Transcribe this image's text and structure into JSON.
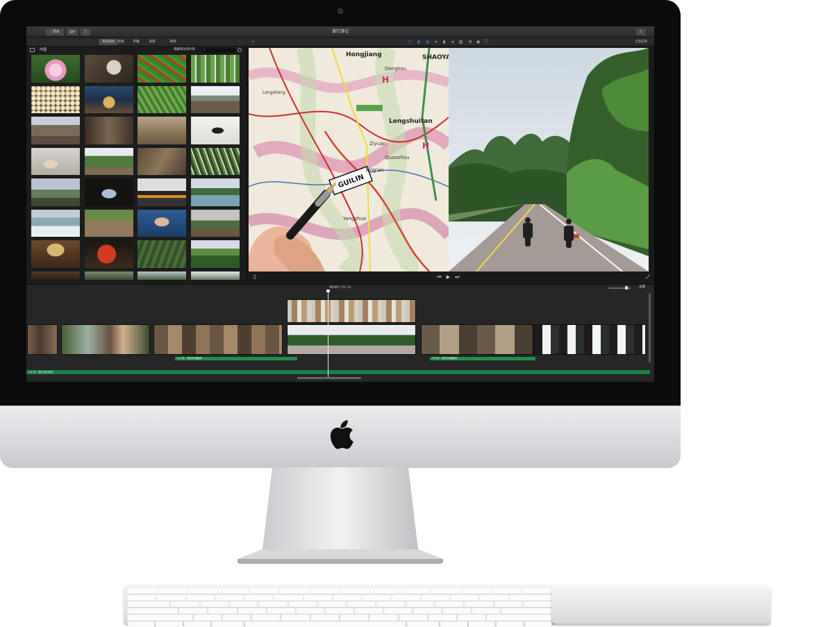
{
  "app": {
    "window_title": "旅行游记",
    "back_button_label": "项目",
    "tabs": [
      "我的媒体",
      "音频",
      "字幕",
      "背景",
      "转场"
    ],
    "reset_all_label": "全部还原"
  },
  "library": {
    "title": "中国",
    "filter_label": "隐藏用过的片段",
    "search_placeholder": ""
  },
  "viewer": {
    "map_labels": [
      "Hongjiang",
      "SHAOYA",
      "Dongkou",
      "Lengshuitan",
      "GUILIN",
      "Ziyuan",
      "Quanzhou",
      "Xing'an",
      "Yangshuo",
      "Longsheng"
    ]
  },
  "timeline": {
    "timecode_current": "00:45",
    "timecode_total": "01:33",
    "settings_label": "设置",
    "audio_clips": [
      {
        "label": "2.1 秒 – 摩托车辆轰声"
      },
      {
        "label": "5.8 秒 – 摩托车辆轰声"
      }
    ],
    "background_music": "1.6 分 – 旅行游记音乐"
  },
  "colors": {
    "audio_green": "#1f8f4b",
    "accent_blue": "#3b8cf0",
    "bezel": "#0b0b0c"
  }
}
